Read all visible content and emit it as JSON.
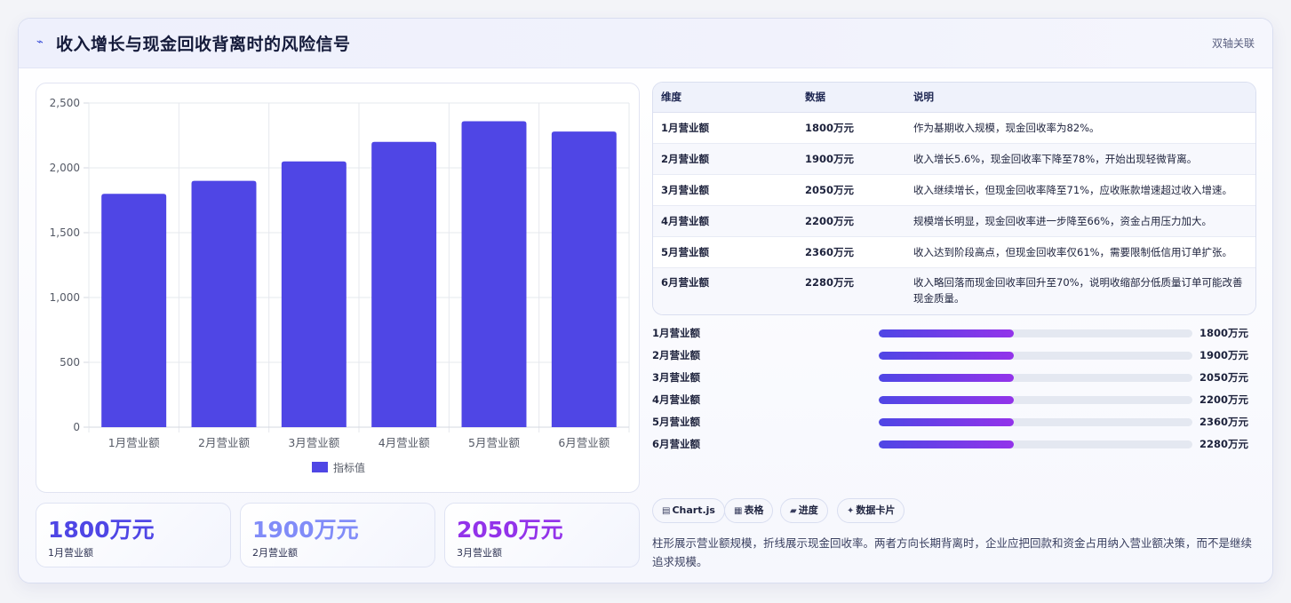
{
  "header": {
    "title": "收入增长与现金回收背离时的风险信号",
    "tag": "双轴关联",
    "icon": "trend-line-icon"
  },
  "chart_data": {
    "type": "bar",
    "categories": [
      "1月营业额",
      "2月营业额",
      "3月营业额",
      "4月营业额",
      "5月营业额",
      "6月营业额"
    ],
    "series": [
      {
        "name": "指标值",
        "values": [
          1800,
          1900,
          2050,
          2200,
          2360,
          2280
        ],
        "color": "#4f46e5"
      }
    ],
    "ylim": [
      0,
      2500
    ],
    "yticks": [
      0,
      500,
      1000,
      1500,
      2000,
      2500
    ],
    "ytick_labels": [
      "0",
      "500",
      "1,000",
      "1,500",
      "2,000",
      "2,500"
    ],
    "grid": true,
    "legend": "bottom"
  },
  "kpis": [
    {
      "value": "1800万元",
      "label": "1月营业额",
      "color": "#4f46e5"
    },
    {
      "value": "1900万元",
      "label": "2月营业额",
      "color": "#818cf8"
    },
    {
      "value": "2050万元",
      "label": "3月营业额",
      "color": "#9333ea"
    }
  ],
  "table": {
    "headers": [
      "维度",
      "数据",
      "说明"
    ],
    "rows": [
      {
        "dim": "1月营业额",
        "data": "1800万元",
        "desc": "作为基期收入规模，现金回收率为82%。"
      },
      {
        "dim": "2月营业额",
        "data": "1900万元",
        "desc": "收入增长5.6%，现金回收率下降至78%，开始出现轻微背离。"
      },
      {
        "dim": "3月营业额",
        "data": "2050万元",
        "desc": "收入继续增长，但现金回收率降至71%，应收账款增速超过收入增速。"
      },
      {
        "dim": "4月营业额",
        "data": "2200万元",
        "desc": "规模增长明显，现金回收率进一步降至66%，资金占用压力加大。"
      },
      {
        "dim": "5月营业额",
        "data": "2360万元",
        "desc": "收入达到阶段高点，但现金回收率仅61%，需要限制低信用订单扩张。"
      },
      {
        "dim": "6月营业额",
        "data": "2280万元",
        "desc": "收入略回落而现金回收率回升至70%，说明收缩部分低质量订单可能改善现金质量。"
      }
    ]
  },
  "progress": [
    {
      "label": "1月营业额",
      "value": "1800万元",
      "fill": 0.43
    },
    {
      "label": "2月营业额",
      "value": "1900万元",
      "fill": 0.43
    },
    {
      "label": "3月营业额",
      "value": "2050万元",
      "fill": 0.43
    },
    {
      "label": "4月营业额",
      "value": "2200万元",
      "fill": 0.43
    },
    {
      "label": "5月营业额",
      "value": "2360万元",
      "fill": 0.43
    },
    {
      "label": "6月营业额",
      "value": "2280万元",
      "fill": 0.43
    }
  ],
  "chips": [
    {
      "icon": "chart-icon",
      "glyph": "▤",
      "label": "Chart.js"
    },
    {
      "icon": "table-icon",
      "glyph": "▦",
      "label": "表格"
    },
    {
      "icon": "progress-icon",
      "glyph": "▰",
      "label": "进度"
    },
    {
      "icon": "sparkle-icon",
      "glyph": "✦",
      "label": "数据卡片"
    }
  ],
  "note": "柱形展示营业额规模，折线展示现金回收率。两者方向长期背离时，企业应把回款和资金占用纳入营业额决策，而不是继续追求规模。"
}
